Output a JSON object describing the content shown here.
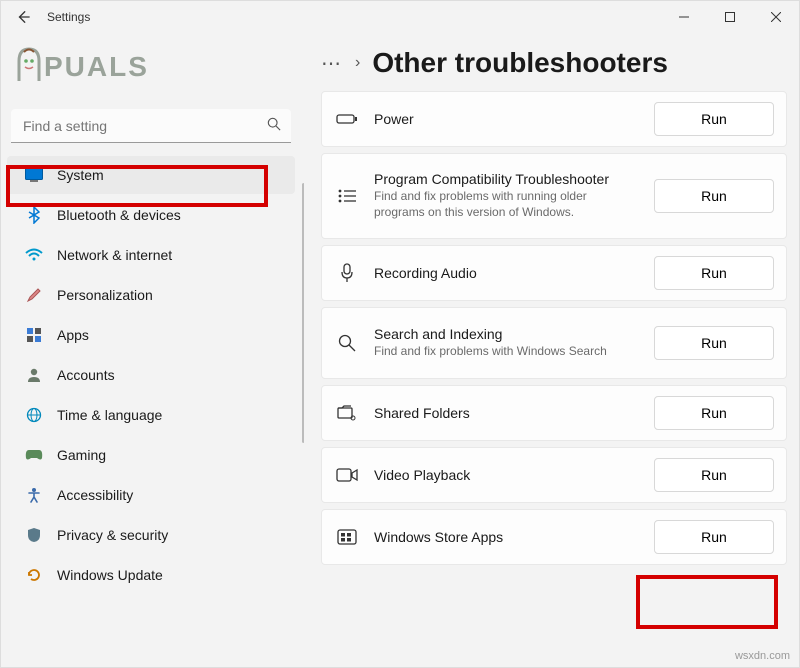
{
  "window": {
    "title": "Settings"
  },
  "search": {
    "placeholder": "Find a setting"
  },
  "logo": {
    "text_rest": "PUALS"
  },
  "sidebar": {
    "items": [
      {
        "label": "System"
      },
      {
        "label": "Bluetooth & devices"
      },
      {
        "label": "Network & internet"
      },
      {
        "label": "Personalization"
      },
      {
        "label": "Apps"
      },
      {
        "label": "Accounts"
      },
      {
        "label": "Time & language"
      },
      {
        "label": "Gaming"
      },
      {
        "label": "Accessibility"
      },
      {
        "label": "Privacy & security"
      },
      {
        "label": "Windows Update"
      }
    ]
  },
  "breadcrumb": {
    "title": "Other troubleshooters"
  },
  "troubleshooters": [
    {
      "title": "Power",
      "desc": "",
      "run": "Run"
    },
    {
      "title": "Program Compatibility Troubleshooter",
      "desc": "Find and fix problems with running older programs on this version of Windows.",
      "run": "Run"
    },
    {
      "title": "Recording Audio",
      "desc": "",
      "run": "Run"
    },
    {
      "title": "Search and Indexing",
      "desc": "Find and fix problems with Windows Search",
      "run": "Run"
    },
    {
      "title": "Shared Folders",
      "desc": "",
      "run": "Run"
    },
    {
      "title": "Video Playback",
      "desc": "",
      "run": "Run"
    },
    {
      "title": "Windows Store Apps",
      "desc": "",
      "run": "Run"
    }
  ],
  "watermark": "wsxdn.com"
}
